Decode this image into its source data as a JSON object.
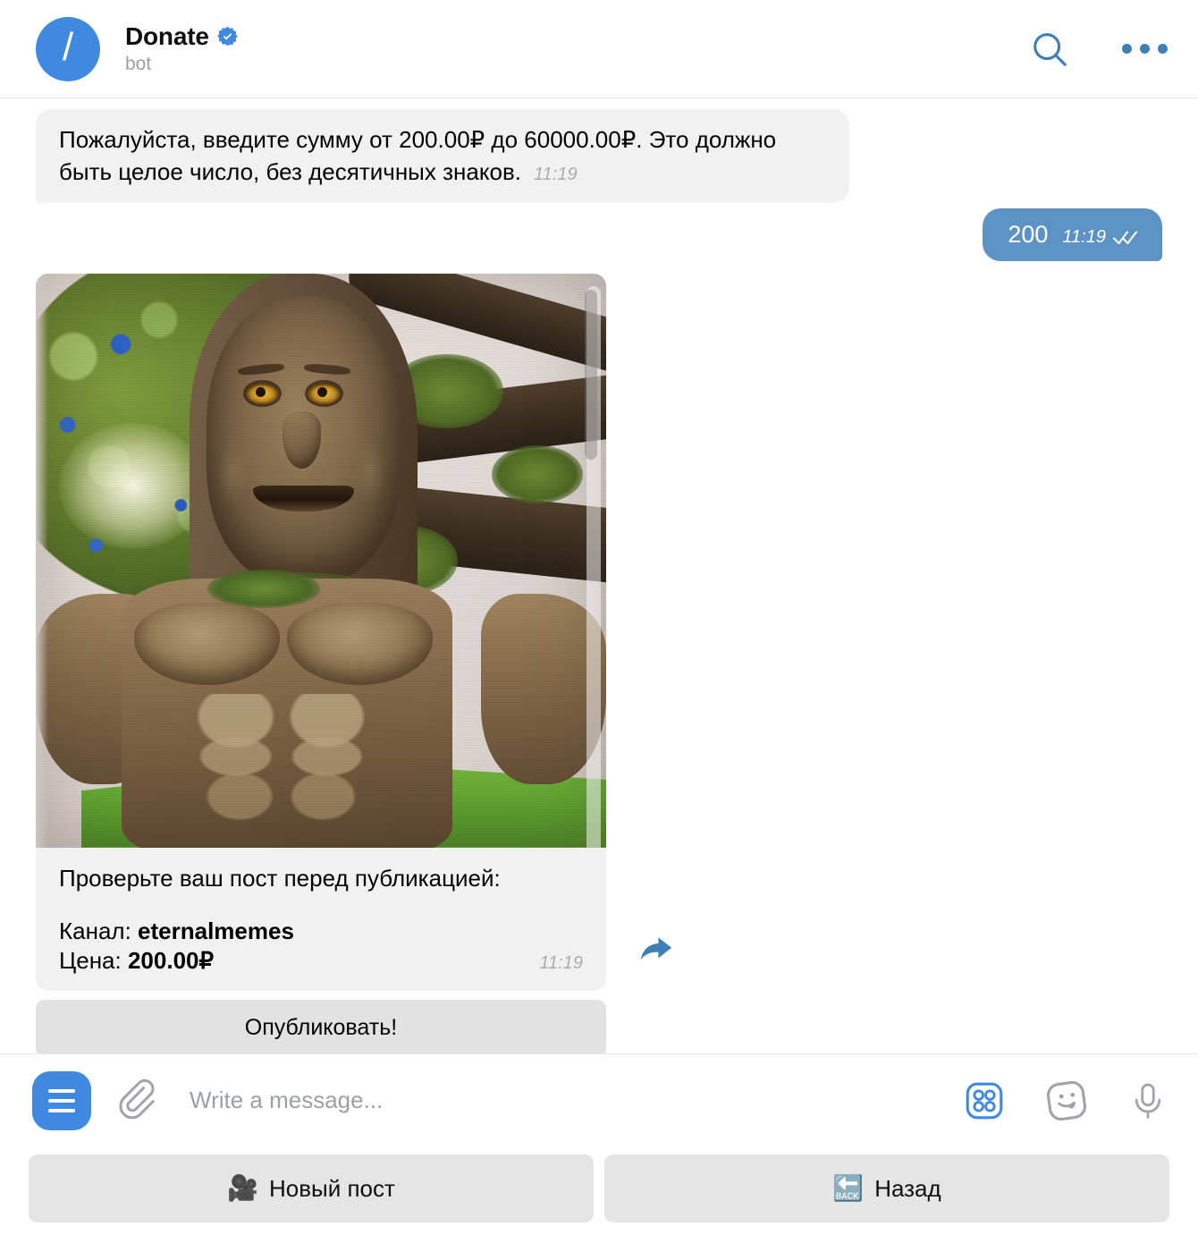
{
  "colors": {
    "accent": "#3f8ae0",
    "header_icon": "#3e7fb8",
    "out_bubble": "#5d93c4",
    "in_bubble": "#f1f1f1",
    "inline_button": "#e2e2e2",
    "reply_button": "#e5e5e5",
    "muted_text": "#9aa0a6",
    "time_text": "#a8adb3"
  },
  "header": {
    "avatar_glyph": "/",
    "title": "Donate",
    "verified_icon": "verified-badge-icon",
    "status": "bot",
    "search_icon": "search-icon",
    "more_icon": "more-options-icon"
  },
  "messages": [
    {
      "id": "msg-bot-prompt",
      "direction": "in",
      "text": "Пожалуйста, введите сумму от 200.00₽ до 60000.00₽. Это должно быть целое число, без десятичных знаков.",
      "time": "11:19"
    },
    {
      "id": "msg-user-amount",
      "direction": "out",
      "text": "200",
      "time": "11:19",
      "status_icon": "double-check-icon"
    },
    {
      "id": "msg-bot-preview",
      "direction": "in",
      "type": "photo",
      "photo_alt": "wise-mystical-tree-meme",
      "caption_line1": "Проверьте ваш пост перед публикацией:",
      "caption_channel_label": "Канал: ",
      "caption_channel_value": "eternalmemes",
      "caption_price_label": "Цена: ",
      "caption_price_value": "200.00₽",
      "time": "11:19",
      "forward_icon": "forward-arrow-icon",
      "inline_buttons": [
        {
          "label": "Опубликовать!"
        }
      ]
    }
  ],
  "composer": {
    "menu_icon": "menu-hamburger-icon",
    "attach_icon": "paperclip-icon",
    "placeholder": "Write a message...",
    "value": "",
    "bot_commands_icon": "bot-commands-grid-icon",
    "sticker_icon": "sticker-smiley-icon",
    "voice_icon": "microphone-icon"
  },
  "reply_keyboard": {
    "buttons": [
      {
        "emoji": "🎥",
        "label": "Новый пост",
        "emoji_name": "movie-camera-emoji"
      },
      {
        "emoji": "🔙",
        "label": "Назад",
        "emoji_name": "back-arrow-emoji"
      }
    ]
  }
}
